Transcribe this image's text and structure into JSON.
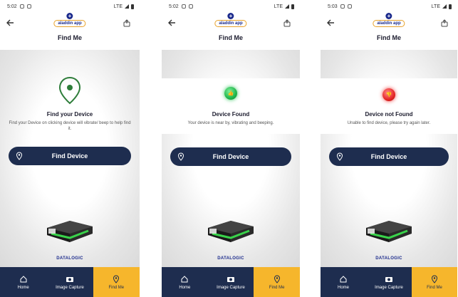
{
  "screens": [
    {
      "status_time": "5:02",
      "status_net": "LTE",
      "logo_text": "aladdin app",
      "title": "Find Me",
      "state_title": "Find your Device",
      "state_desc": "Find your Device on clicking device will vibrate/ beep to help find it.",
      "state_icon": "location-pin-icon",
      "button_label": "Find Device",
      "brand": "DATALOGIC",
      "tabs": [
        {
          "label": "Home",
          "icon": "home-icon"
        },
        {
          "label": "Image Capture",
          "icon": "camera-icon"
        },
        {
          "label": "Find Me",
          "icon": "location-pin-icon"
        }
      ]
    },
    {
      "status_time": "5:02",
      "status_net": "LTE",
      "logo_text": "aladdin app",
      "title": "Find Me",
      "state_title": "Device Found",
      "state_desc": "Your device is near by, vibrating and beeping.",
      "state_icon": "thumbs-up-icon",
      "button_label": "Find Device",
      "brand": "DATALOGIC",
      "tabs": [
        {
          "label": "Home",
          "icon": "home-icon"
        },
        {
          "label": "Image Capture",
          "icon": "camera-icon"
        },
        {
          "label": "Find Me",
          "icon": "location-pin-icon"
        }
      ]
    },
    {
      "status_time": "5:03",
      "status_net": "LTE",
      "logo_text": "aladdin app",
      "title": "Find Me",
      "state_title": "Device not Found",
      "state_desc": "Unable to find device, please try again later.",
      "state_icon": "thumbs-down-icon",
      "button_label": "Find Device",
      "brand": "DATALOGIC",
      "tabs": [
        {
          "label": "Home",
          "icon": "home-icon"
        },
        {
          "label": "Image Capture",
          "icon": "camera-icon"
        },
        {
          "label": "Find Me",
          "icon": "location-pin-icon"
        }
      ]
    }
  ],
  "colors": {
    "navy": "#1e2d4f",
    "accent": "#f6b62c",
    "found": "#1fb54a",
    "not_found": "#e52525",
    "pin": "#2e7d3a"
  },
  "active_tab": "Find Me"
}
